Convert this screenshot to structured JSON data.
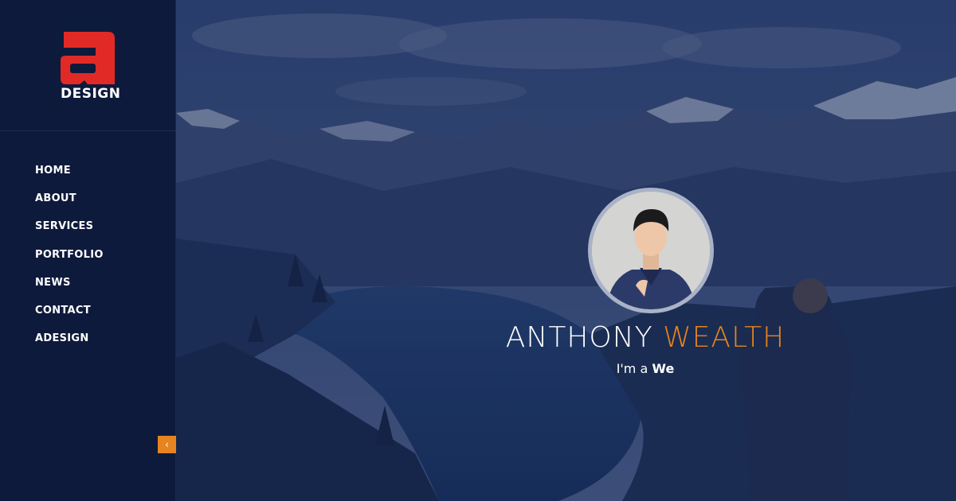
{
  "brand": {
    "logo_text": "DESIGN",
    "logo_color": "#e12a26"
  },
  "nav": {
    "items": [
      {
        "label": "HOME"
      },
      {
        "label": "ABOUT"
      },
      {
        "label": "SERVICES"
      },
      {
        "label": "PORTFOLIO"
      },
      {
        "label": "NEWS"
      },
      {
        "label": "CONTACT"
      },
      {
        "label": "ADESIGN"
      }
    ],
    "toggle_icon": "chevron-left-icon",
    "toggle_glyph": "‹"
  },
  "hero": {
    "name_first": "ANTHONY",
    "name_last": "WEALTH",
    "tagline_prefix": "I'm a",
    "tagline_role": "We",
    "accent_color": "#e6841f"
  }
}
